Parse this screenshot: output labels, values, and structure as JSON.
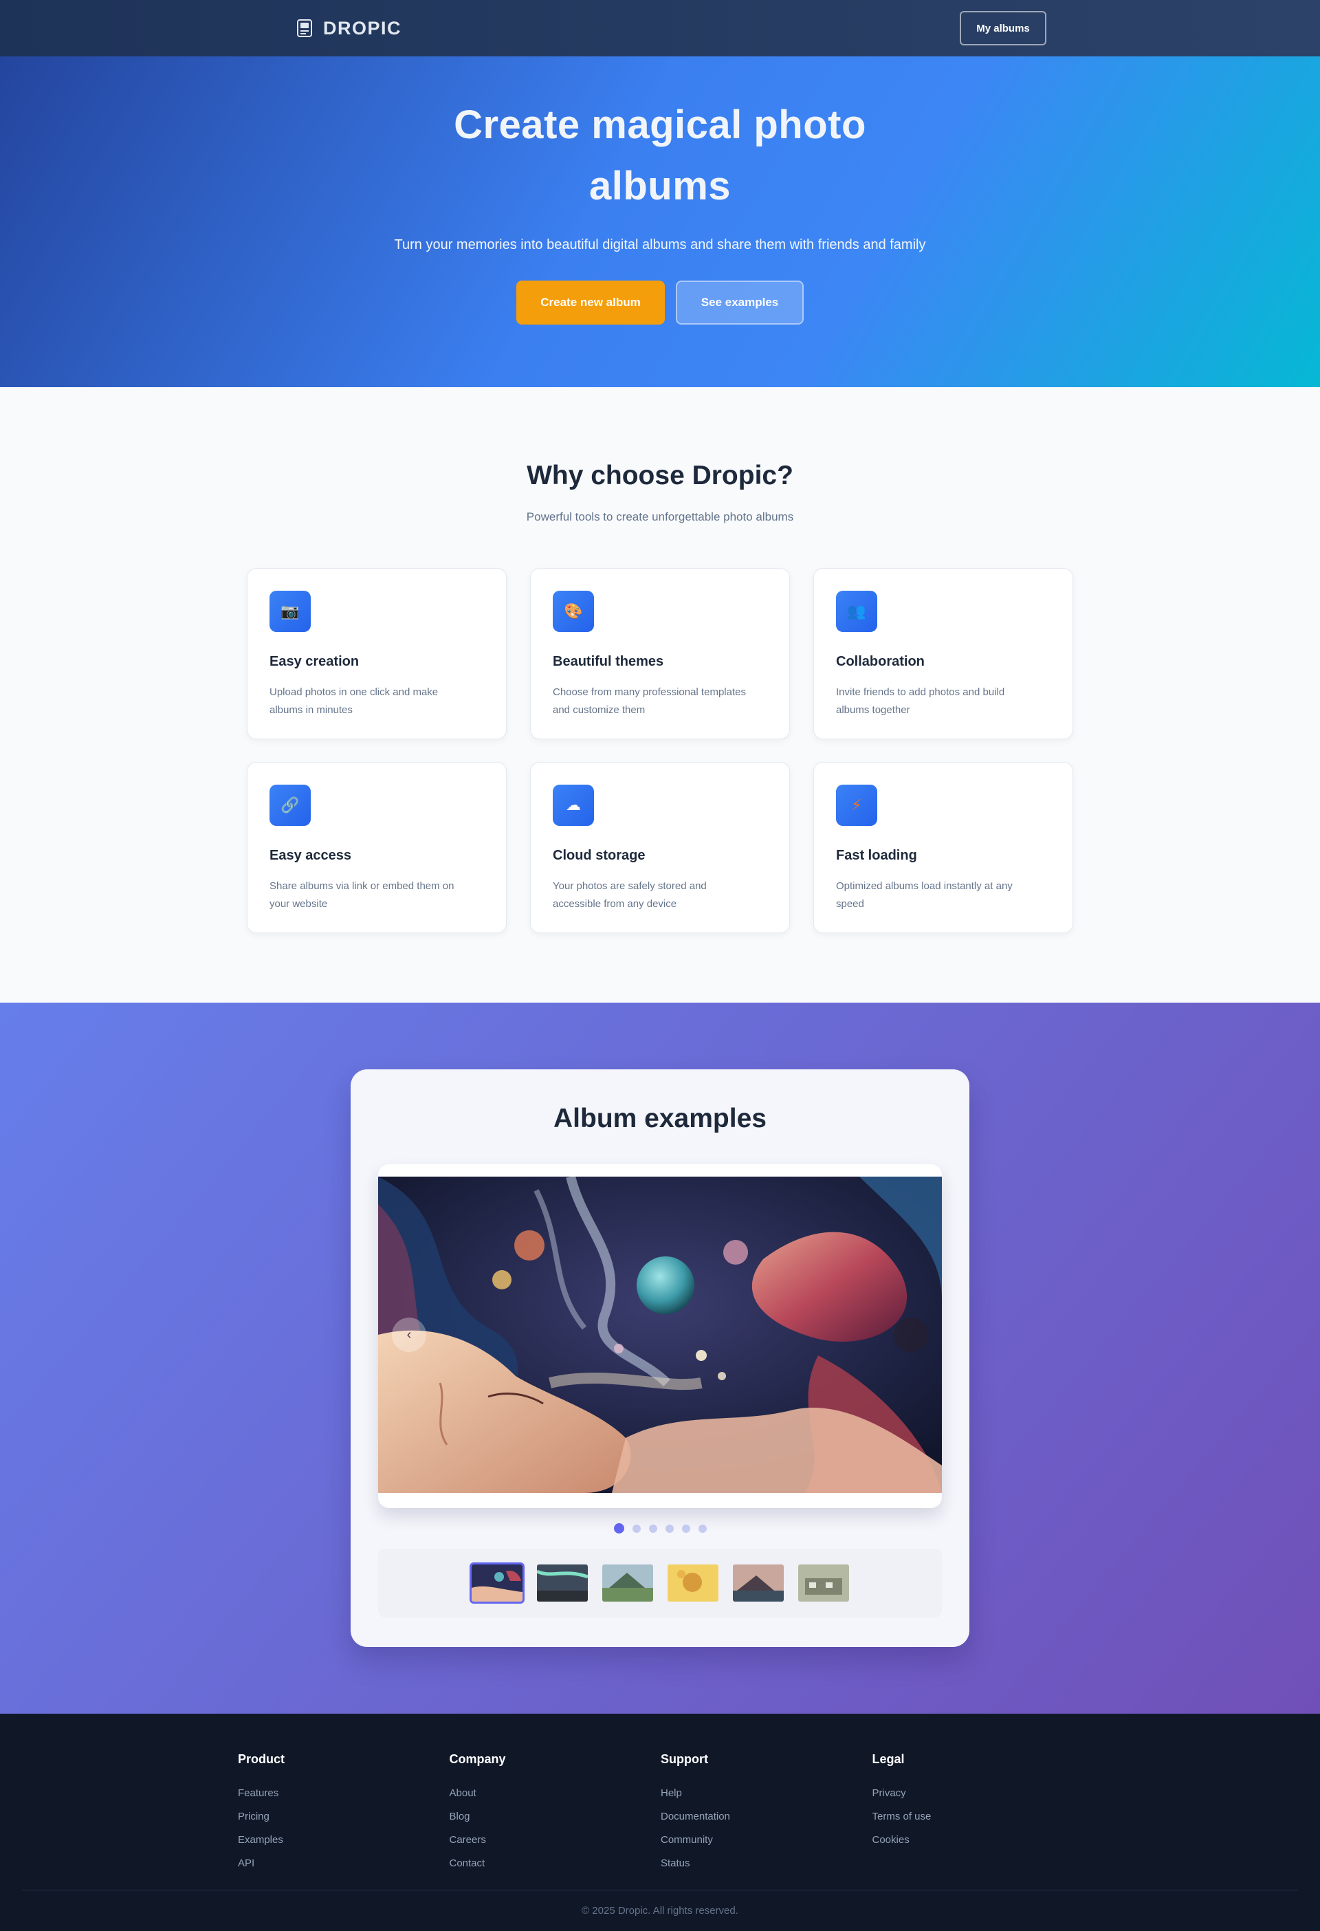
{
  "nav": {
    "brand": "DROPIC",
    "my_albums": "My albums"
  },
  "hero": {
    "title": "Create magical photo albums",
    "subtitle": "Turn your memories into beautiful digital albums and share them with friends and family",
    "primary_cta": "Create new album",
    "secondary_cta": "See examples"
  },
  "features": {
    "title": "Why choose Dropic?",
    "subtitle": "Powerful tools to create unforgettable photo albums",
    "items": [
      {
        "icon": "camera-icon",
        "glyph": "📷",
        "title": "Easy creation",
        "desc": "Upload photos in one click and make albums in minutes"
      },
      {
        "icon": "palette-icon",
        "glyph": "🎨",
        "title": "Beautiful themes",
        "desc": "Choose from many professional templates and customize them"
      },
      {
        "icon": "users-icon",
        "glyph": "👥",
        "title": "Collaboration",
        "desc": "Invite friends to add photos and build albums together"
      },
      {
        "icon": "link-icon",
        "glyph": "🔗",
        "title": "Easy access",
        "desc": "Share albums via link or embed them on your website"
      },
      {
        "icon": "cloud-icon",
        "glyph": "☁",
        "title": "Cloud storage",
        "desc": "Your photos are safely stored and accessible from any device"
      },
      {
        "icon": "lightning-icon",
        "glyph": "⚡",
        "title": "Fast loading",
        "desc": "Optimized albums load instantly at any speed"
      }
    ]
  },
  "examples": {
    "title": "Album examples",
    "prev_glyph": "‹",
    "next_glyph": "›",
    "slide_count": 6,
    "active_index": 0
  },
  "footer": {
    "columns": [
      {
        "title": "Product",
        "links": [
          "Features",
          "Pricing",
          "Examples",
          "API"
        ]
      },
      {
        "title": "Company",
        "links": [
          "About",
          "Blog",
          "Careers",
          "Contact"
        ]
      },
      {
        "title": "Support",
        "links": [
          "Help",
          "Documentation",
          "Community",
          "Status"
        ]
      },
      {
        "title": "Legal",
        "links": [
          "Privacy",
          "Terms of use",
          "Cookies"
        ]
      }
    ],
    "copyright": "© 2025 Dropic. All rights reserved."
  },
  "colors": {
    "accent": "#f59e0b",
    "primary": "#3b82f6",
    "indicator": "#6366f1",
    "footer_bg": "#101828"
  }
}
